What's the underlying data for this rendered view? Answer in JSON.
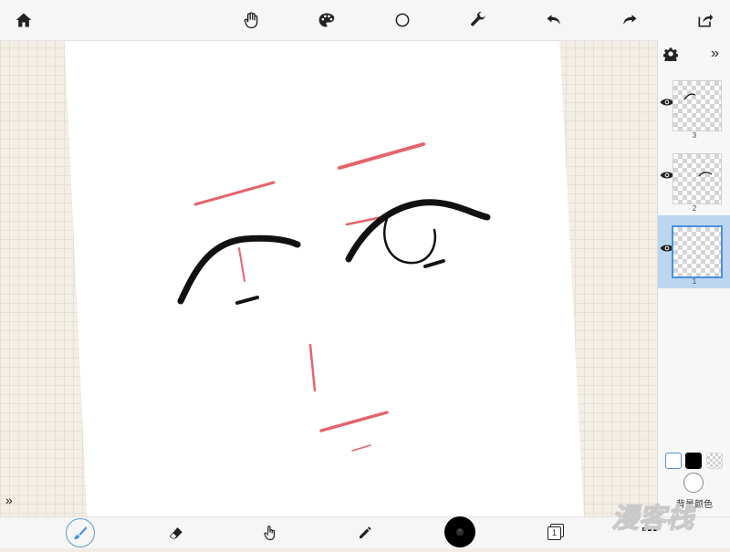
{
  "toolbar_top": {
    "home_icon": "home-icon",
    "hand_icon": "hand-icon",
    "palette_icon": "palette-icon",
    "circle_icon": "circle-icon",
    "wrench_icon": "wrench-icon",
    "undo_icon": "undo-icon",
    "redo_icon": "redo-icon",
    "share_icon": "share-icon"
  },
  "toolbar_bottom": {
    "brush_icon": "brush-icon",
    "eraser_icon": "eraser-icon",
    "finger_icon": "finger-icon",
    "pencil_icon": "pencil-icon",
    "current_color": "#000000",
    "page_label": "1",
    "more_icon": "more-icon"
  },
  "layers": {
    "items": [
      {
        "number": "3",
        "visible": true,
        "active": false
      },
      {
        "number": "2",
        "visible": true,
        "active": false
      },
      {
        "number": "1",
        "visible": true,
        "active": true
      }
    ],
    "background_label": "背景颜色"
  },
  "colors": {
    "accent": "#4a90e2",
    "active_layer_bg": "#bcd6f0",
    "sketch_red": "#e0585e",
    "ink": "#111111"
  }
}
